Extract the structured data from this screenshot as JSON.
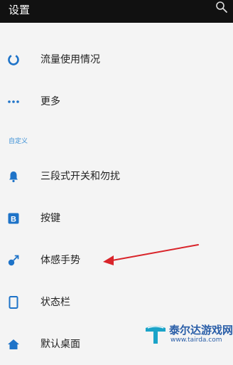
{
  "header": {
    "title": "设置",
    "search_icon": "search-icon"
  },
  "items": [
    {
      "label": "流量使用情况",
      "icon": "data-usage-icon"
    },
    {
      "label": "更多",
      "icon": "more-dots-icon"
    }
  ],
  "section": {
    "title": "自定义"
  },
  "custom_items": [
    {
      "label": "三段式开关和勿扰",
      "icon": "bell-icon"
    },
    {
      "label": "按键",
      "icon": "button-b-icon"
    },
    {
      "label": "体感手势",
      "icon": "gesture-icon"
    },
    {
      "label": "状态栏",
      "icon": "phone-icon"
    },
    {
      "label": "默认桌面",
      "icon": "home-icon"
    }
  ],
  "colors": {
    "accent": "#1e73c8",
    "annotation": "#d9242a"
  },
  "watermark": {
    "name": "泰尔达游戏网",
    "url": "www.tairda.com"
  }
}
